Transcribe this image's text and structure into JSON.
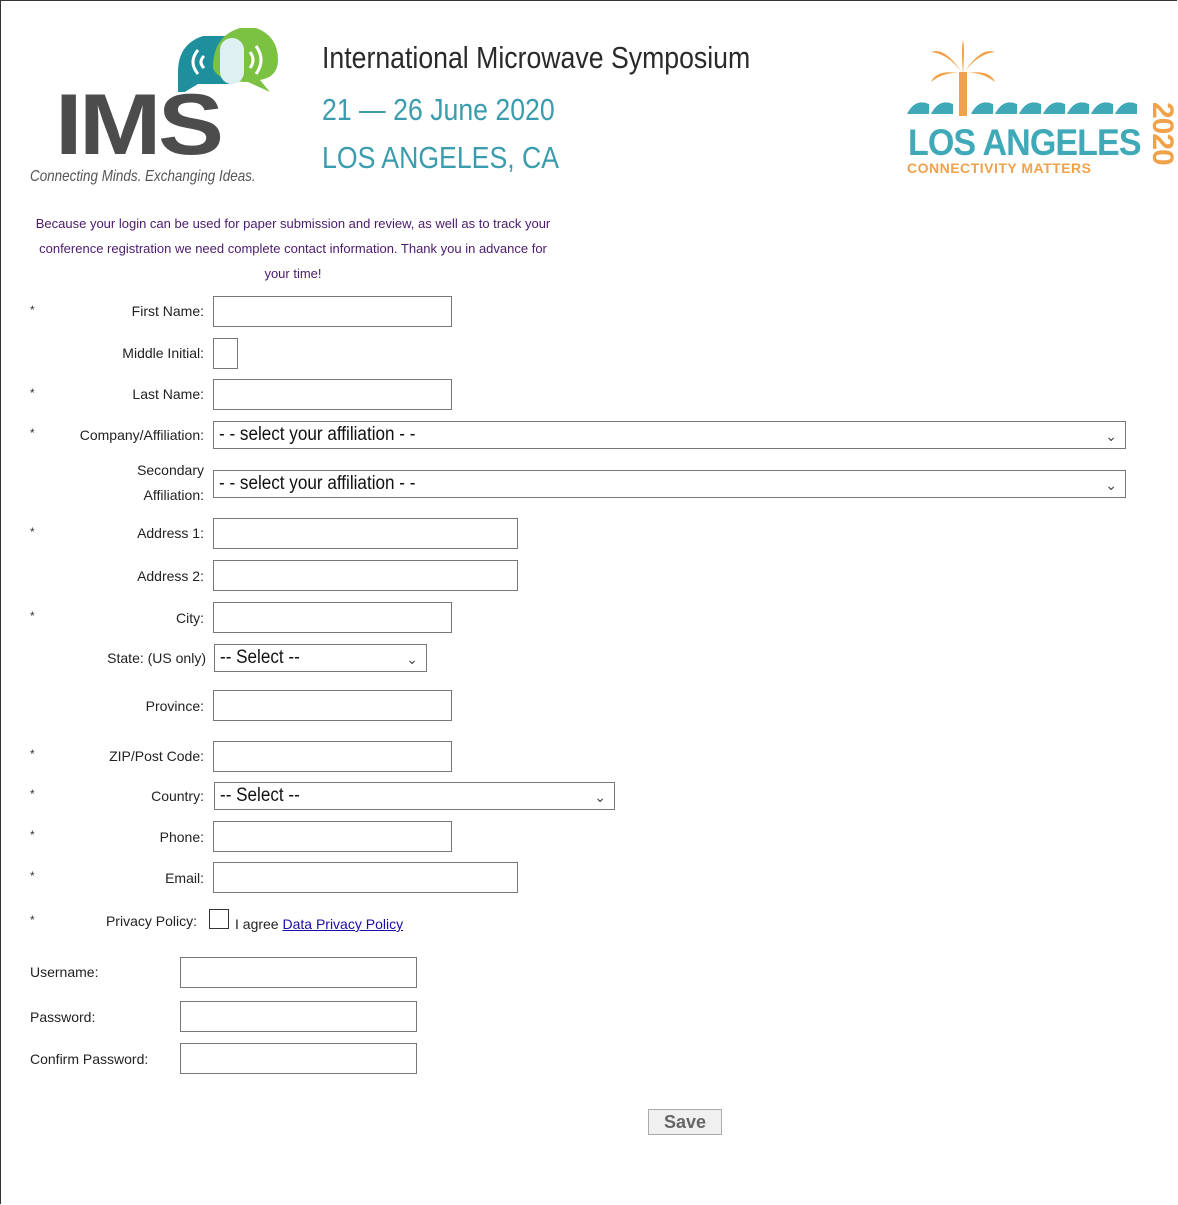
{
  "header": {
    "ims_logo_text": "IMS",
    "ims_tagline": "Connecting Minds. Exchanging Ideas.",
    "conference_name": "International Microwave Symposium",
    "dates": "21 — 26 June 2020",
    "location": "LOS ANGELES, CA",
    "la_logo_city": "LOS ANGELES",
    "la_logo_tagline": "CONNECTIVITY MATTERS",
    "la_logo_year": "2020"
  },
  "intro": "Because your login can be used for paper submission and review, as well as to track your conference registration we need complete contact information. Thank you in advance for your time!",
  "required_marker": "*",
  "fields": {
    "first_name": {
      "label": "First Name:",
      "value": ""
    },
    "middle_initial": {
      "label": "Middle Initial:",
      "value": ""
    },
    "last_name": {
      "label": "Last Name:",
      "value": ""
    },
    "company": {
      "label": "Company/Affiliation:",
      "selected": "- - select your affiliation - -"
    },
    "secondary_affiliation": {
      "label_line1": "Secondary",
      "label_line2": "Affiliation:",
      "selected": "- - select your affiliation - -"
    },
    "address1": {
      "label": "Address 1:",
      "value": ""
    },
    "address2": {
      "label": "Address 2:",
      "value": ""
    },
    "city": {
      "label": "City:",
      "value": ""
    },
    "state": {
      "label": "State: (US only)",
      "selected": "-- Select --"
    },
    "province": {
      "label": "Province:",
      "value": ""
    },
    "zip": {
      "label": "ZIP/Post Code:",
      "value": ""
    },
    "country": {
      "label": "Country:",
      "selected": "-- Select --"
    },
    "phone": {
      "label": "Phone:",
      "value": ""
    },
    "email": {
      "label": "Email:",
      "value": ""
    },
    "privacy": {
      "label": "Privacy Policy:",
      "agree_text": "I agree",
      "link_text": "Data Privacy Policy",
      "checked": false
    }
  },
  "account": {
    "username": {
      "label": "Username:",
      "value": ""
    },
    "password": {
      "label": "Password:",
      "value": ""
    },
    "confirm_password": {
      "label": "Confirm Password:",
      "value": ""
    }
  },
  "save_label": "Save",
  "colors": {
    "intro_text": "#4b1a6e",
    "accent_teal": "#3b9cae",
    "accent_orange": "#f0a24a",
    "link": "#1a0dab"
  }
}
